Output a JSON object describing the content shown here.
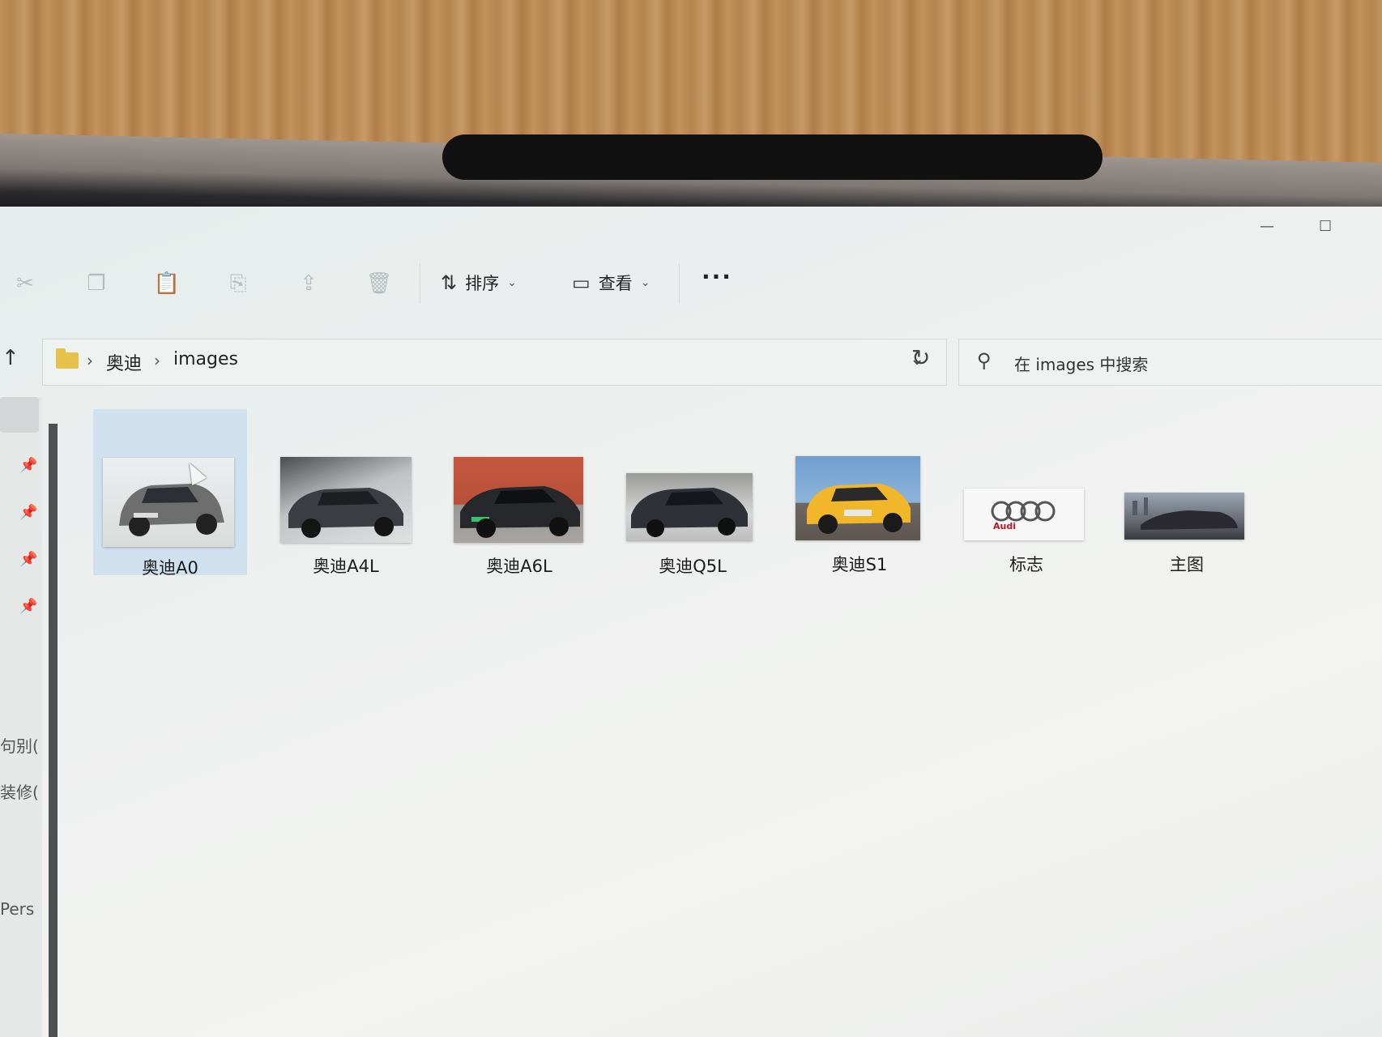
{
  "toolbar": {
    "icons": [
      "cut-icon",
      "copy-icon",
      "paste-icon",
      "rename-icon",
      "share-icon",
      "delete-icon"
    ],
    "sort_label": "排序",
    "view_label": "查看",
    "more_label": "···"
  },
  "address": {
    "crumbs": [
      "奥迪",
      "images"
    ]
  },
  "search": {
    "placeholder": "在 images 中搜索"
  },
  "nav": {
    "text_items": [
      "句别(",
      "装修(",
      "Pers"
    ]
  },
  "files": [
    {
      "name": "奥迪A0",
      "selected": true,
      "thumb": "gray-hatchback"
    },
    {
      "name": "奥迪A4L",
      "selected": false,
      "thumb": "dark-sedan"
    },
    {
      "name": "奥迪A6L",
      "selected": false,
      "thumb": "black-sedan-red-wall"
    },
    {
      "name": "奥迪Q5L",
      "selected": false,
      "thumb": "dark-suv"
    },
    {
      "name": "奥迪S1",
      "selected": false,
      "thumb": "yellow-hatchback"
    },
    {
      "name": "标志",
      "selected": false,
      "thumb": "audi-logo",
      "logo_text": "Audi"
    },
    {
      "name": "主图",
      "selected": false,
      "thumb": "car-landscape"
    }
  ],
  "colors": {
    "selection": "#cfe1ee",
    "folder": "#e7c24a",
    "audi_red": "#cc1122"
  }
}
